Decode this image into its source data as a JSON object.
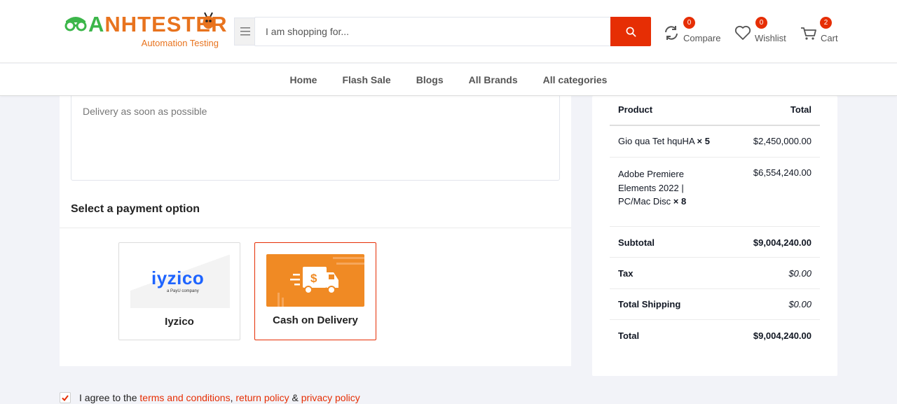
{
  "header": {
    "logo_main_g": "A",
    "logo_main_rest": "NHTESTER",
    "logo_sub": "Automation Testing",
    "search_placeholder": "I am shopping for...",
    "compare": {
      "label": "Compare",
      "count": "0"
    },
    "wishlist": {
      "label": "Wishlist",
      "count": "0"
    },
    "cart": {
      "label": "Cart",
      "count": "2"
    }
  },
  "nav": {
    "items": [
      "Home",
      "Flash Sale",
      "Blogs",
      "All Brands",
      "All categories"
    ]
  },
  "checkout": {
    "note_placeholder": "Delivery as soon as possible",
    "payment_title": "Select a payment option",
    "payment_options": [
      {
        "name": "Iyzico",
        "logo_text": "iyzico",
        "logo_sub": "a PayU company",
        "selected": false
      },
      {
        "name": "Cash on Delivery",
        "icon": "truck-dollar-icon",
        "selected": true
      }
    ],
    "agree": {
      "checked": true,
      "text_prefix": "I agree to the",
      "terms": "terms and conditions",
      "comma": ",",
      "return": "return policy",
      "amp": "&",
      "privacy": "privacy policy"
    }
  },
  "summary": {
    "head_product": "Product",
    "head_total": "Total",
    "items": [
      {
        "name": "Gio qua Tet hquHA",
        "qty": "× 5",
        "price": "$2,450,000.00"
      },
      {
        "name_lines": [
          "Adobe Premiere",
          "Elements 2022 |",
          "PC/Mac Disc"
        ],
        "qty": "× 8",
        "price": "$6,554,240.00"
      }
    ],
    "subtotal_label": "Subtotal",
    "subtotal": "$9,004,240.00",
    "tax_label": "Tax",
    "tax": "$0.00",
    "shipping_label": "Total Shipping",
    "shipping": "$0.00",
    "total_label": "Total",
    "total": "$9,004,240.00"
  },
  "colors": {
    "accent": "#e62e04",
    "logo_green": "#3cb64a",
    "logo_orange": "#e8731e",
    "cod_orange": "#f08a24",
    "iyzico_blue": "#1e64ff"
  }
}
